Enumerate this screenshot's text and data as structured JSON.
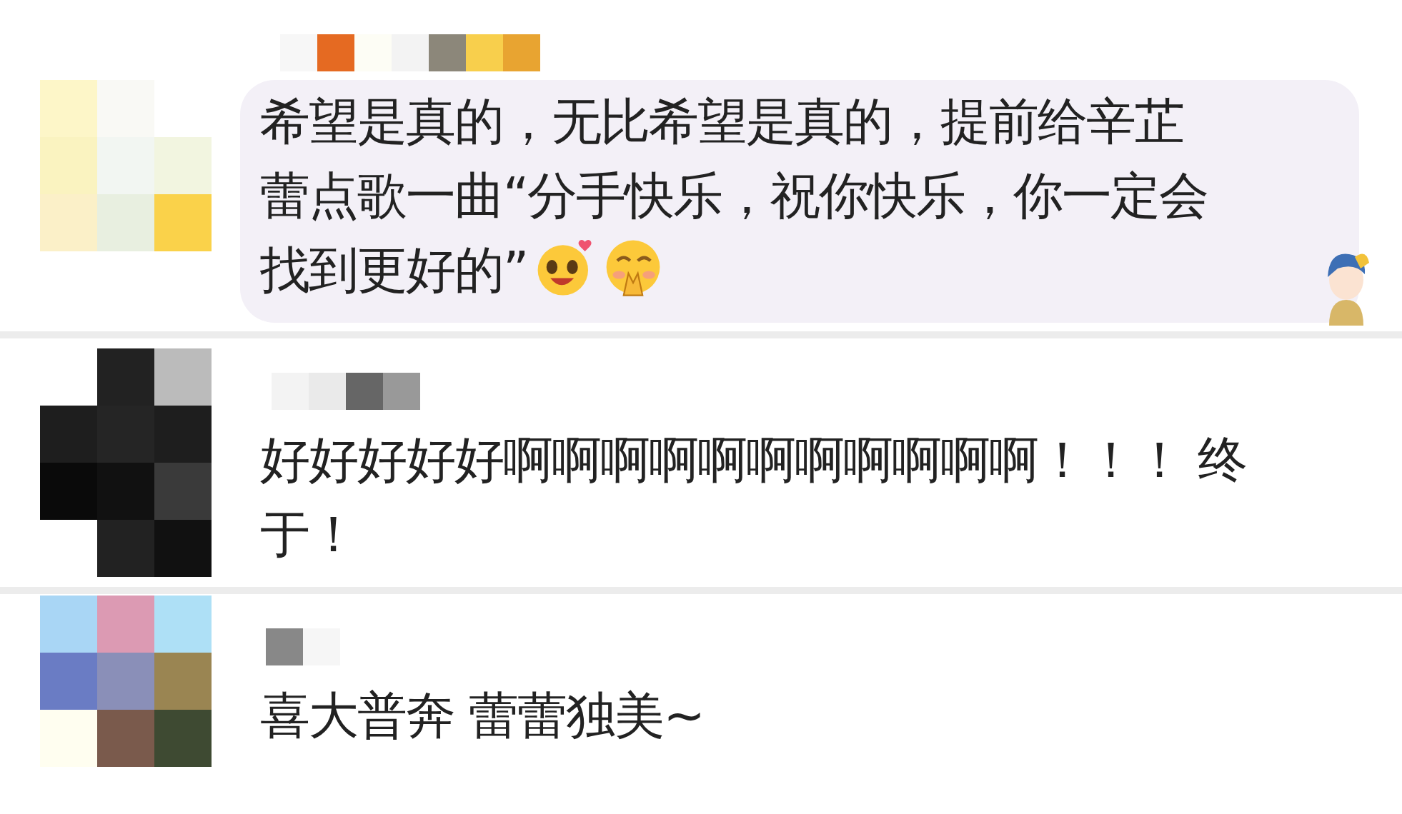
{
  "comments": [
    {
      "lines": [
        "希望是真的，无比希望是真的，提前给辛芷",
        "蕾点歌一曲“分手快乐，祝你快乐，你一定会",
        "找到更好的”"
      ],
      "highlighted": true,
      "emojis": [
        {
          "kind": "hearts-face"
        },
        {
          "kind": "pleading-face"
        }
      ],
      "sticker": {
        "kind": "figure"
      }
    },
    {
      "lines": [
        "好好好好好啊啊啊啊啊啊啊啊啊啊啊！！！ 终",
        "于！"
      ],
      "highlighted": false
    },
    {
      "lines": [
        "喜大普奔 蕾蕾独美~"
      ],
      "highlighted": false
    }
  ]
}
